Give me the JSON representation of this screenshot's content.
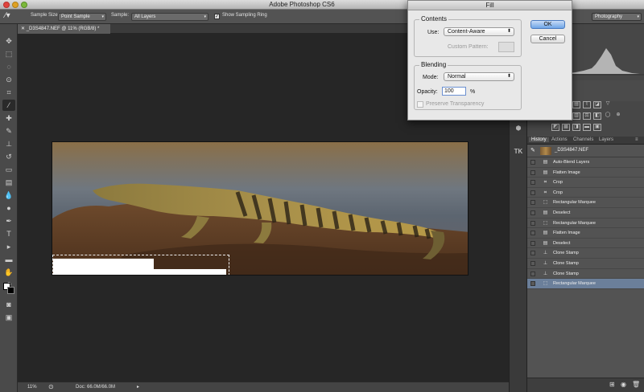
{
  "app": {
    "title": "Adobe Photoshop CS6"
  },
  "options_bar": {
    "sample_size_label": "Sample Size:",
    "sample_size_value": "Point Sample",
    "sample_label": "Sample:",
    "sample_value": "All Layers",
    "show_ring_label": "Show Sampling Ring",
    "workspace": "Photography"
  },
  "document": {
    "tab_label": "_D3S4847.NEF @ 11% (RGB/8) *"
  },
  "status": {
    "zoom": "11%",
    "doc_info": "Doc: 66.0M/66.0M"
  },
  "history": {
    "tabs": [
      "History",
      "Actions",
      "Channels",
      "Layers"
    ],
    "snapshot": "_D3S4847.NEF",
    "items": [
      {
        "label": "Auto-Blend Layers",
        "icon": "doc-icon"
      },
      {
        "label": "Flatten Image",
        "icon": "doc-icon"
      },
      {
        "label": "Crop",
        "icon": "crop-icon"
      },
      {
        "label": "Crop",
        "icon": "crop-icon"
      },
      {
        "label": "Rectangular Marquee",
        "icon": "marquee-icon"
      },
      {
        "label": "Deselect",
        "icon": "doc-icon"
      },
      {
        "label": "Rectangular Marquee",
        "icon": "marquee-icon"
      },
      {
        "label": "Flatten Image",
        "icon": "doc-icon"
      },
      {
        "label": "Deselect",
        "icon": "doc-icon"
      },
      {
        "label": "Clone Stamp",
        "icon": "stamp-icon"
      },
      {
        "label": "Clone Stamp",
        "icon": "stamp-icon"
      },
      {
        "label": "Clone Stamp",
        "icon": "stamp-icon"
      },
      {
        "label": "Rectangular Marquee",
        "icon": "marquee-icon"
      }
    ],
    "selected_index": 12
  },
  "dialog": {
    "title": "Fill",
    "contents_group": "Contents",
    "use_label": "Use:",
    "use_value": "Content-Aware",
    "custom_pattern_label": "Custom Pattern:",
    "blending_group": "Blending",
    "mode_label": "Mode:",
    "mode_value": "Normal",
    "opacity_label": "Opacity:",
    "opacity_value": "100",
    "opacity_unit": "%",
    "preserve_label": "Preserve Transparency",
    "ok_label": "OK",
    "cancel_label": "Cancel"
  }
}
